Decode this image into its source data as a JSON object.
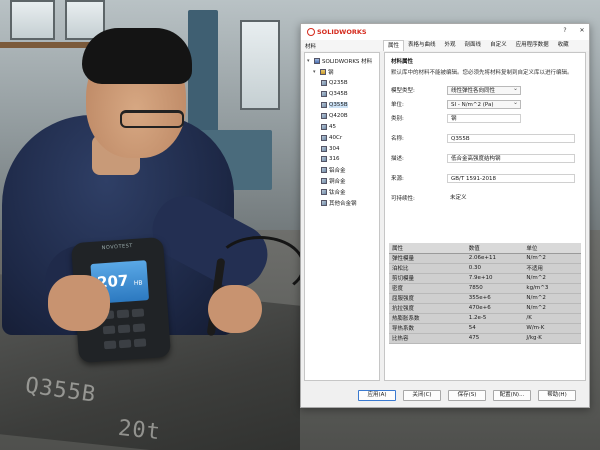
{
  "dialog": {
    "app_name": "SOLIDWORKS",
    "window_buttons": {
      "help": "?",
      "close": "✕"
    },
    "panel_header": "材料",
    "tabs": [
      {
        "label": "属性"
      },
      {
        "label": "表格与曲线"
      },
      {
        "label": "外观"
      },
      {
        "label": "剖面线"
      },
      {
        "label": "自定义"
      },
      {
        "label": "应用程序数据"
      },
      {
        "label": "收藏"
      }
    ],
    "tree": {
      "root": "SOLIDWORKS 材料",
      "group": "钢",
      "items": [
        "Q235B",
        "Q345B",
        "Q355B",
        "Q420B",
        "45",
        "40Cr",
        "304",
        "316",
        "铝合金",
        "铜合金",
        "钛合金",
        "其他合金钢"
      ],
      "selected_index": 2
    },
    "properties": {
      "section_title": "材料属性",
      "note": "默认库中的材料不能被编辑。您必须先将材料复制到自定义库以进行编辑。",
      "model_type_label": "模型类型:",
      "model_type_value": "线性弹性各向同性",
      "units_label": "单位:",
      "units_value": "SI - N/m^2 (Pa)",
      "category_label": "类别:",
      "category_value": "钢",
      "name_label": "名称:",
      "name_value": "Q355B",
      "description_label": "描述:",
      "description_value": "低合金高强度结构钢",
      "source_label": "来源:",
      "source_value": "GB/T 1591-2018",
      "sustainability_label": "可持续性:",
      "sustainability_value": "未定义"
    },
    "table": {
      "headers": [
        "属性",
        "数值",
        "单位"
      ],
      "rows": [
        [
          "弹性模量",
          "2.06e+11",
          "N/m^2"
        ],
        [
          "泊松比",
          "0.30",
          "不适用"
        ],
        [
          "剪切模量",
          "7.9e+10",
          "N/m^2"
        ],
        [
          "密度",
          "7850",
          "kg/m^3"
        ],
        [
          "屈服强度",
          "355e+6",
          "N/m^2"
        ],
        [
          "抗拉强度",
          "470e+6",
          "N/m^2"
        ],
        [
          "热膨胀系数",
          "1.2e-5",
          "/K"
        ],
        [
          "导热系数",
          "54",
          "W/m·K"
        ],
        [
          "比热容",
          "475",
          "J/kg·K"
        ]
      ]
    },
    "buttons": {
      "apply": "应用(A)",
      "close": "关闭(C)",
      "save": "保存(S)",
      "config": "配置(N)...",
      "help": "帮助(H)"
    }
  },
  "photo": {
    "device_brand": "NOVOTEST",
    "device_reading": "207",
    "device_unit": "HB",
    "plate_marks": [
      "Q355B",
      "20t"
    ]
  },
  "colors": {
    "solidworks_red": "#d52b1e",
    "selection": "#cde3f7",
    "device_screen": "#3b8fd6"
  }
}
